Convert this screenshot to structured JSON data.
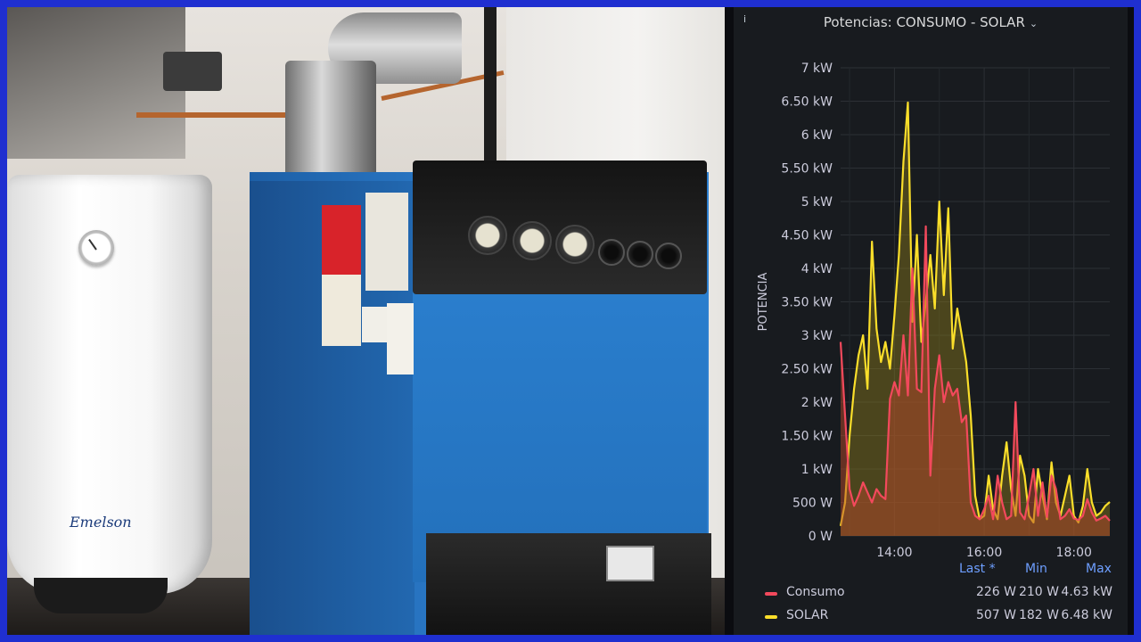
{
  "panel": {
    "title": "Potencias: CONSUMO - SOLAR",
    "info_icon": "i",
    "chevron": "⌄"
  },
  "heater": {
    "brand": "Emelson"
  },
  "legend": {
    "headers": [
      "Last *",
      "Min",
      "Max"
    ],
    "rows": [
      {
        "name": "Consumo",
        "color": "#f2495c",
        "last": "226 W",
        "min": "210 W",
        "max": "4.63 kW"
      },
      {
        "name": "SOLAR",
        "color": "#fade2a",
        "last": "507 W",
        "min": "182 W",
        "max": "6.48 kW"
      }
    ]
  },
  "chart_data": {
    "type": "area",
    "title": "Potencias: CONSUMO - SOLAR",
    "xlabel": "",
    "ylabel": "POTENCIA",
    "y_ticks": [
      "0 W",
      "500 W",
      "1 kW",
      "1.50 kW",
      "2 kW",
      "2.50 kW",
      "3 kW",
      "3.50 kW",
      "4 kW",
      "4.50 kW",
      "5 kW",
      "5.50 kW",
      "6 kW",
      "6.50 kW",
      "7 kW"
    ],
    "ylim": [
      0,
      7000
    ],
    "x_ticks": [
      "14:00",
      "16:00",
      "18:00"
    ],
    "x_tick_hours": [
      14,
      16,
      18
    ],
    "xlim": [
      12.8,
      18.8
    ],
    "grid": true,
    "legend": "bottom",
    "series": [
      {
        "name": "SOLAR",
        "color": "#fade2a",
        "x": [
          12.8,
          12.9,
          13.0,
          13.1,
          13.2,
          13.3,
          13.4,
          13.5,
          13.6,
          13.7,
          13.8,
          13.9,
          14.0,
          14.1,
          14.2,
          14.3,
          14.4,
          14.5,
          14.6,
          14.7,
          14.8,
          14.9,
          15.0,
          15.1,
          15.2,
          15.3,
          15.4,
          15.5,
          15.6,
          15.7,
          15.8,
          15.9,
          16.0,
          16.1,
          16.2,
          16.3,
          16.4,
          16.5,
          16.6,
          16.7,
          16.8,
          16.9,
          17.0,
          17.1,
          17.2,
          17.3,
          17.4,
          17.5,
          17.6,
          17.7,
          17.8,
          17.9,
          18.0,
          18.1,
          18.2,
          18.3,
          18.4,
          18.5,
          18.6,
          18.7,
          18.8
        ],
        "values": [
          150,
          500,
          1500,
          2200,
          2700,
          3000,
          2200,
          4400,
          3100,
          2600,
          2900,
          2500,
          3300,
          4200,
          5600,
          6480,
          3200,
          4500,
          2900,
          3500,
          4200,
          3400,
          5000,
          3600,
          4900,
          2800,
          3400,
          3000,
          2600,
          1800,
          600,
          250,
          300,
          900,
          400,
          250,
          900,
          1400,
          700,
          300,
          1200,
          900,
          300,
          200,
          1000,
          600,
          250,
          1100,
          500,
          300,
          600,
          900,
          300,
          200,
          450,
          1000,
          500,
          300,
          350,
          450,
          507
        ]
      },
      {
        "name": "Consumo",
        "color": "#f2495c",
        "x": [
          12.8,
          12.9,
          13.0,
          13.1,
          13.2,
          13.3,
          13.4,
          13.5,
          13.6,
          13.7,
          13.8,
          13.9,
          14.0,
          14.1,
          14.2,
          14.3,
          14.4,
          14.5,
          14.6,
          14.7,
          14.8,
          14.9,
          15.0,
          15.1,
          15.2,
          15.3,
          15.4,
          15.5,
          15.6,
          15.7,
          15.8,
          15.9,
          16.0,
          16.1,
          16.2,
          16.3,
          16.4,
          16.5,
          16.6,
          16.7,
          16.8,
          16.9,
          17.0,
          17.1,
          17.2,
          17.3,
          17.4,
          17.5,
          17.6,
          17.7,
          17.8,
          17.9,
          18.0,
          18.1,
          18.2,
          18.3,
          18.4,
          18.5,
          18.6,
          18.7,
          18.8
        ],
        "values": [
          2900,
          1800,
          700,
          450,
          600,
          800,
          650,
          500,
          700,
          600,
          550,
          2050,
          2300,
          2100,
          3000,
          2100,
          4000,
          2200,
          2150,
          4630,
          900,
          2200,
          2700,
          2000,
          2300,
          2100,
          2200,
          1700,
          1800,
          500,
          300,
          250,
          400,
          600,
          250,
          900,
          500,
          250,
          300,
          2000,
          350,
          250,
          600,
          1000,
          300,
          800,
          280,
          900,
          700,
          250,
          300,
          400,
          260,
          240,
          300,
          550,
          350,
          230,
          260,
          300,
          226
        ]
      }
    ]
  }
}
